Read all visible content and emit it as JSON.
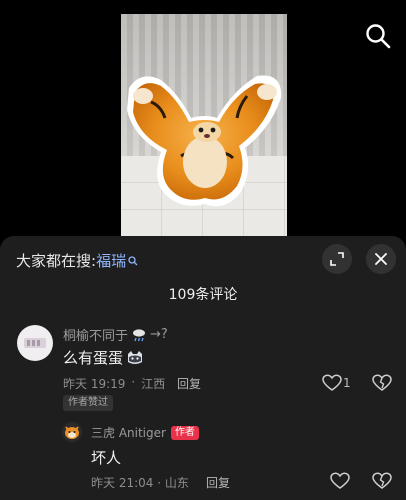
{
  "header": {
    "search_icon": "search-icon"
  },
  "search_hint": {
    "prefix": "大家都在搜:",
    "keyword": "福瑞",
    "icon": "search-small-icon"
  },
  "comments_count": "109条评论",
  "comments": [
    {
      "username": "桐榆不同于",
      "username_suffix": "→?",
      "text": "么有蛋蛋",
      "time": "昨天 19:19",
      "location": "江西",
      "reply_label": "回复",
      "likes": "1",
      "author_liked_label": "作者赞过"
    },
    {
      "username": "三虎 Anitiger",
      "badge": "作者",
      "text": "坏人",
      "time": "昨天 21:04",
      "location": "山东",
      "reply_label": "回复"
    }
  ],
  "colors": {
    "sheet_bg": "#1e1e1e",
    "keyword": "#8fb6ff",
    "badge": "#e9324a"
  }
}
